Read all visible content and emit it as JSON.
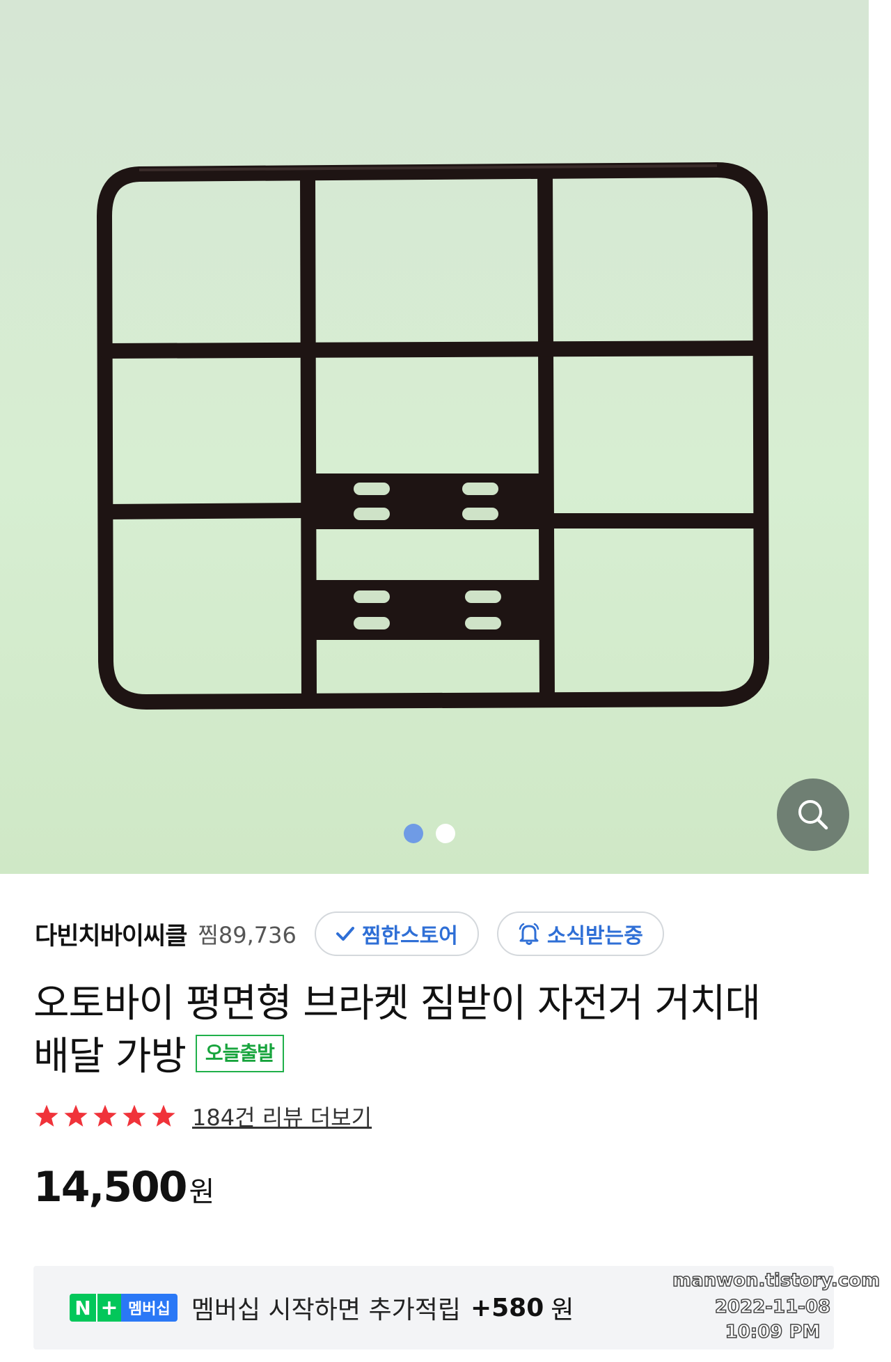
{
  "gallery": {
    "image_alt": "",
    "dots": [
      {
        "active": true
      },
      {
        "active": false
      }
    ],
    "zoom_icon": "search-icon"
  },
  "seller": {
    "name": "다빈치바이씨클",
    "jjim_count": "찜89,736",
    "jjim_store_label": "찜한스토어",
    "notify_label": "소식받는중"
  },
  "product": {
    "title_line1": "오토바이 평면형 브라켓 짐받이 자전거 거치대",
    "title_line2": "배달 가방",
    "badge": "오늘출발"
  },
  "rating": {
    "stars": 5,
    "review_link": "184건 리뷰 더보기"
  },
  "price": {
    "amount": "14,500",
    "unit": "원"
  },
  "membership": {
    "n_label": "N",
    "plus_label": "+",
    "tag_label": "멤버십",
    "text": "멤버십 시작하면 추가적립",
    "points": "+580",
    "unit": "원"
  },
  "watermark": {
    "site": "manwon.tistory.com",
    "date": "2022-11-08",
    "time": "10:09 PM"
  },
  "colors": {
    "accent_blue": "#2f6fd6",
    "badge_green": "#18a43d",
    "star_red": "#f0333a",
    "naver_green": "#03c75a"
  }
}
